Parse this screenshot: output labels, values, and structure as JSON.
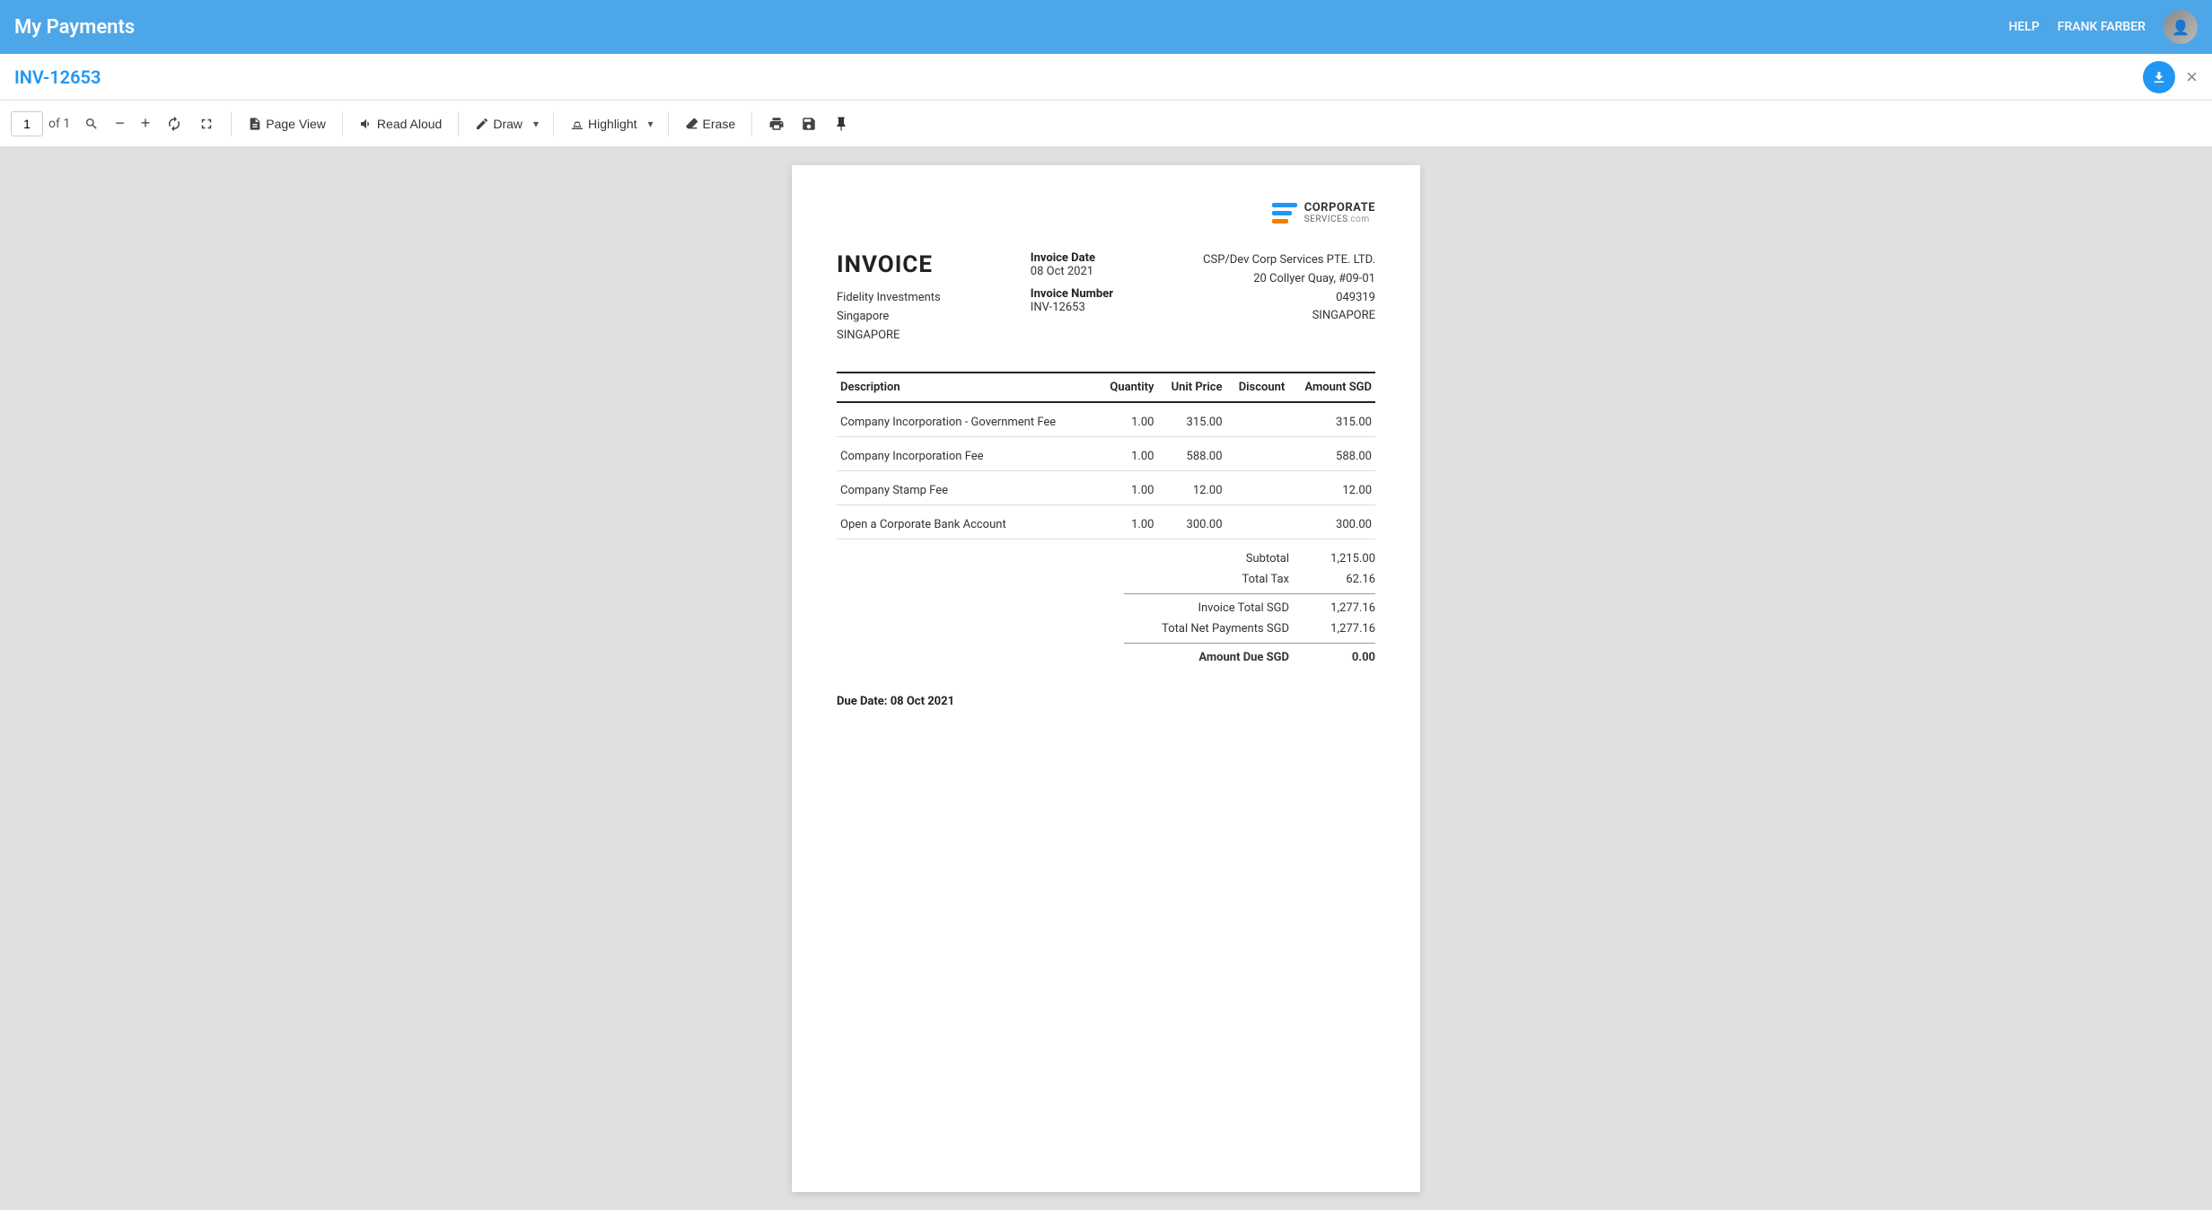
{
  "header": {
    "title": "My Payments",
    "help_label": "HELP",
    "user_name": "FRANK FARBER"
  },
  "subheader": {
    "invoice_id": "INV-12653",
    "close_icon": "×",
    "download_icon": "⬇"
  },
  "toolbar": {
    "page_number": "1",
    "of_label": "of 1",
    "minus_icon": "−",
    "plus_icon": "+",
    "page_view_label": "Page View",
    "read_aloud_label": "Read Aloud",
    "draw_label": "Draw",
    "highlight_label": "Highlight",
    "erase_label": "Erase"
  },
  "invoice": {
    "company_logo_line1": "CORPORATE",
    "company_logo_line2": "SERVICES",
    "company_logo_suffix": ".com",
    "title": "INVOICE",
    "client_name": "Fidelity Investments",
    "client_city": "Singapore",
    "client_country": "SINGAPORE",
    "invoice_date_label": "Invoice Date",
    "invoice_date_value": "08 Oct 2021",
    "invoice_number_label": "Invoice Number",
    "invoice_number_value": "INV-12653",
    "company_name": "CSP/Dev Corp Services PTE. LTD.",
    "company_address1": "20 Collyer Quay, #09-01",
    "company_address2": "049319",
    "company_address3": "SINGAPORE",
    "table": {
      "headers": [
        "Description",
        "Quantity",
        "Unit Price",
        "Discount",
        "Amount SGD"
      ],
      "rows": [
        {
          "description": "Company Incorporation - Government Fee",
          "quantity": "1.00",
          "unit_price": "315.00",
          "discount": "",
          "amount": "315.00"
        },
        {
          "description": "Company Incorporation Fee",
          "quantity": "1.00",
          "unit_price": "588.00",
          "discount": "",
          "amount": "588.00"
        },
        {
          "description": "Company Stamp Fee",
          "quantity": "1.00",
          "unit_price": "12.00",
          "discount": "",
          "amount": "12.00"
        },
        {
          "description": "Open a Corporate Bank Account",
          "quantity": "1.00",
          "unit_price": "300.00",
          "discount": "",
          "amount": "300.00"
        }
      ],
      "subtotal_label": "Subtotal",
      "subtotal_value": "1,215.00",
      "tax_label": "Total Tax",
      "tax_value": "62.16",
      "invoice_total_label": "Invoice Total SGD",
      "invoice_total_value": "1,277.16",
      "net_payments_label": "Total Net Payments SGD",
      "net_payments_value": "1,277.16",
      "amount_due_label": "Amount Due SGD",
      "amount_due_value": "0.00"
    },
    "due_date_label": "Due Date: 08 Oct 2021"
  }
}
